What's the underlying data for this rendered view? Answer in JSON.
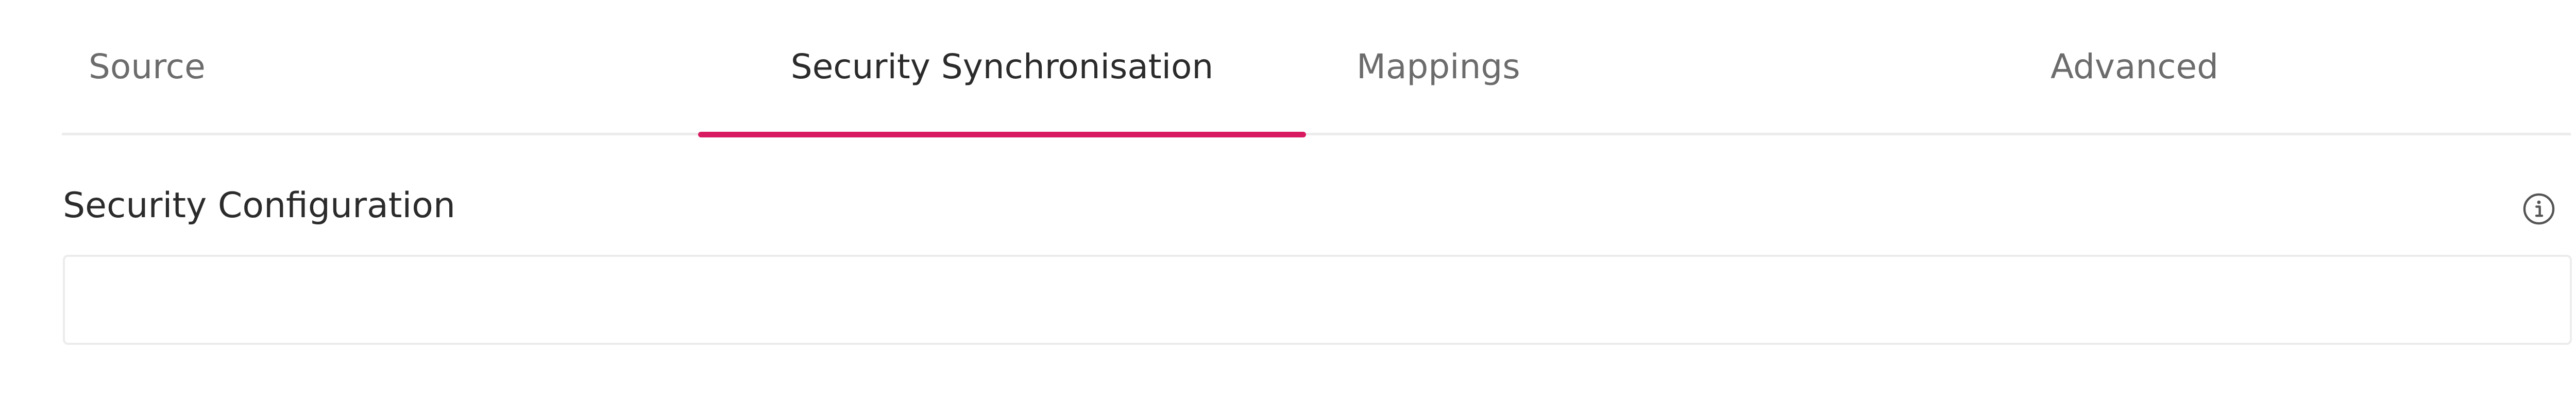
{
  "tabs": [
    {
      "id": "source",
      "label": "Source",
      "active": false
    },
    {
      "id": "security",
      "label": "Security Synchronisation",
      "active": true
    },
    {
      "id": "mappings",
      "label": "Mappings",
      "active": false
    },
    {
      "id": "advanced",
      "label": "Advanced",
      "active": false
    }
  ],
  "section": {
    "title": "Security Configuration",
    "info_icon": "info-icon",
    "field_value": ""
  },
  "colors": {
    "accent": "#d81b60",
    "text_primary": "#2b2b2b",
    "text_muted": "#6c6c6c",
    "border": "#ececec"
  }
}
